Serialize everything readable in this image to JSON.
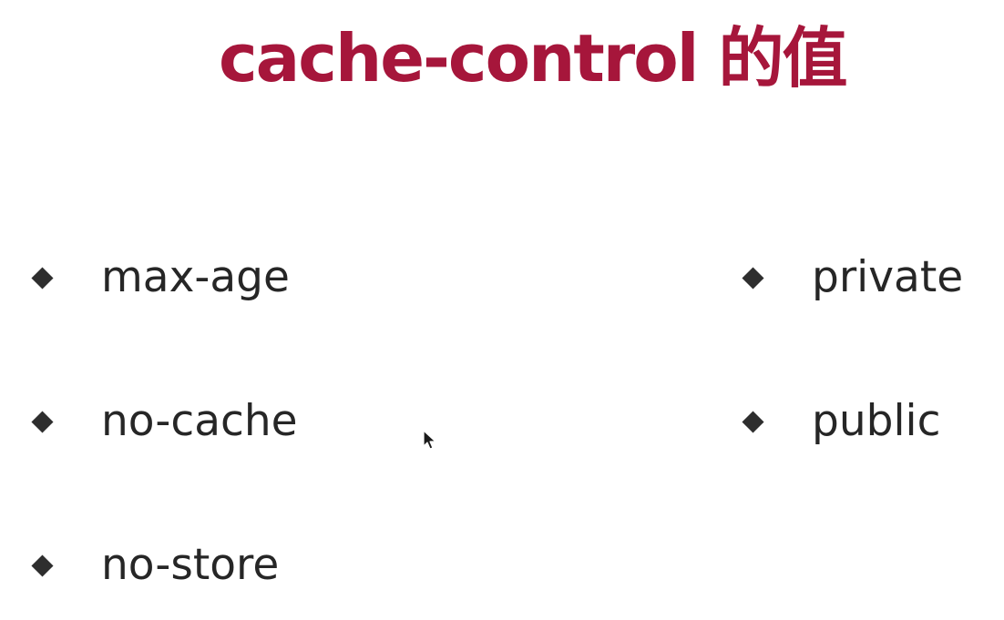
{
  "slide": {
    "title": "cache-control 的值",
    "title_color": "#a6163b",
    "left_items": [
      {
        "label": "max-age",
        "marker_icon": "diamond-bullet-icon"
      },
      {
        "label": "no-cache",
        "marker_icon": "diamond-bullet-icon"
      },
      {
        "label": "no-store",
        "marker_icon": "diamond-bullet-icon"
      }
    ],
    "right_items": [
      {
        "label": "private",
        "marker_icon": "diamond-bullet-icon"
      },
      {
        "label": "public",
        "marker_icon": "diamond-bullet-icon"
      }
    ],
    "cursor_icon": "mouse-pointer-icon"
  }
}
